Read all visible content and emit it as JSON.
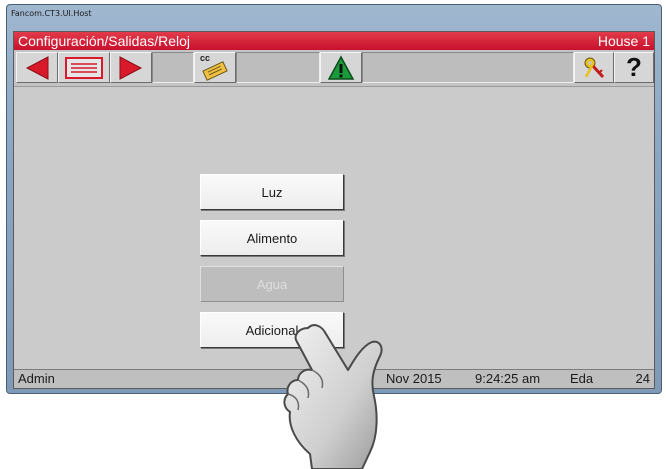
{
  "window": {
    "title": "Fancom.CT3.UI.Host"
  },
  "header": {
    "path": "Configuración/Salidas/Reloj",
    "house": "House 1"
  },
  "toolbar": {
    "prev": "arrow-left-icon",
    "list": "list-card-icon",
    "next": "arrow-right-icon",
    "copy_label": "cc",
    "copy": "copy-card-icon",
    "alarm": "warning-icon",
    "keys": "keys-icon",
    "help": "?"
  },
  "menu": {
    "items": [
      {
        "label": "Luz",
        "enabled": true
      },
      {
        "label": "Alimento",
        "enabled": true
      },
      {
        "label": "Agua",
        "enabled": false
      },
      {
        "label": "Adicional",
        "enabled": true
      }
    ]
  },
  "status": {
    "user": "Admin",
    "date": "Nov 2015",
    "time": "9:24:25 am",
    "age_label": "Eda",
    "age_value": "24"
  },
  "colors": {
    "header": "#c8102e",
    "arrow": "#d7192a",
    "alarm": "#1a9a3a"
  }
}
